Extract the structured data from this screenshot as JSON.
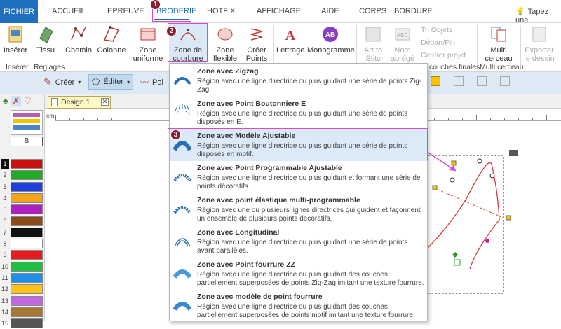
{
  "menubar": {
    "tabs": [
      "FICHIER",
      "ACCUEIL",
      "EPREUVE",
      "BRODERIE",
      "HOTFIX",
      "AFFICHAGE",
      "AIDE",
      "CORPS",
      "BORDURE"
    ],
    "help_placeholder": "Tapez une"
  },
  "badges": [
    "1",
    "2",
    "3"
  ],
  "ribbon": {
    "buttons": {
      "inserer": "Insérer",
      "tissu": "Tissu",
      "chemin": "Chemin",
      "colonne": "Colonne",
      "zone_uniforme": "Zone uniforme",
      "zone_courbure": "Zone de courbure",
      "zone_flexible": "Zone flexible",
      "creer_points": "Créer Points",
      "lettrage": "Lettrage",
      "monogramme": "Monogramme",
      "art_to_stitch": "Art to Stitc",
      "nom_abrege": "Nom abrégé",
      "multi_cerceau": "Multi cerceau",
      "exporter": "Exporter le dessin"
    },
    "small_items": [
      "Tri Objets",
      "Départ/Fin",
      "Centrer projet"
    ],
    "groups": [
      "Insérer",
      "Réglages",
      "couches finales",
      "Multi cerceau"
    ]
  },
  "toolbar2": {
    "creer": "Créer",
    "editer": "Éditer",
    "points": "Poi"
  },
  "document": {
    "tab_name": "Design 1",
    "ruler_unit": "cm"
  },
  "palette": {
    "swatches": [
      {
        "num": "1",
        "color": "#cc1111"
      },
      {
        "num": "2",
        "color": "#22aa22"
      },
      {
        "num": "3",
        "color": "#1f3fe0"
      },
      {
        "num": "4",
        "color": "#f4a418"
      },
      {
        "num": "5",
        "color": "#b020c0"
      },
      {
        "num": "6",
        "color": "#8a4a1a"
      },
      {
        "num": "7",
        "color": "#111111"
      },
      {
        "num": "8",
        "color": "#ffffff"
      },
      {
        "num": "9",
        "color": "#e81c1c"
      },
      {
        "num": "10",
        "color": "#22bb44"
      },
      {
        "num": "11",
        "color": "#1f8fe8"
      },
      {
        "num": "12",
        "color": "#ffc21a"
      },
      {
        "num": "13",
        "color": "#c068e0"
      },
      {
        "num": "14",
        "color": "#a87830"
      },
      {
        "num": "15",
        "color": "#555555"
      }
    ],
    "letter_b": "B"
  },
  "dropdown": {
    "items": [
      {
        "title": "Zone avec Zigzag",
        "desc": "Région avec une ligne directrice ou plus guidant une série de points Zig-Zag."
      },
      {
        "title": "Zone avec Point Boutonniere E",
        "desc": "Région avec une ligne directrice ou plus guidant une série de points disposés en E."
      },
      {
        "title": "Zone avec Modèle Ajustable",
        "desc": "Région avec une ligne directrice ou plus guidant une série de points disposés en motif."
      },
      {
        "title": "Zone avec Point Programmable Ajustable",
        "desc": "Région avec une ligne directrice ou plus guidant et formant une série de points décoratifs."
      },
      {
        "title": "Zone avec point élastique multi-programmable",
        "desc": "Région avec une ou plusieurs lignes directrices qui guident et façonnent un ensemble de plusieurs points décoratifs."
      },
      {
        "title": "Zone avec Longitudinal",
        "desc": "Région avec une ligne directrice ou plus guidant une série de points avant parallèles."
      },
      {
        "title": "Zone avec Point fourrure ZZ",
        "desc": "Région avec une ligne directrice ou plus guidant des couches partiellement superposées de points Zig-Zag imitant une texture fourrure."
      },
      {
        "title": "Zone avec modèle de point fourrure",
        "desc": "Région avec une ligne directrice ou plus guidant des couches partiellement superposées de points motif imitant une texture fourrure."
      }
    ]
  },
  "colors": {
    "accent": "#1e6fc0",
    "highlight_border": "#d74bd3",
    "badge": "#8c1c2f",
    "curve": "#d33a3a"
  }
}
